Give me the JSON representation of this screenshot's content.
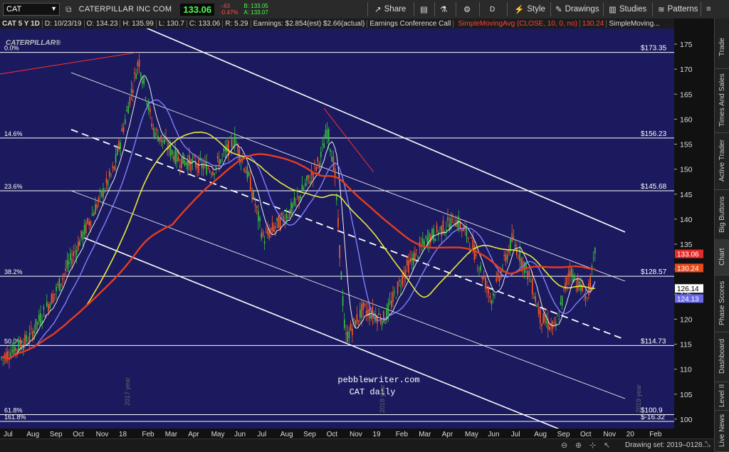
{
  "toolbar": {
    "symbol": "CAT",
    "company": "CATERPILLAR INC COM",
    "last": "133.06",
    "net_change": "-.63",
    "pct_change": "-0.47%",
    "bid": "B: 133.05",
    "ask": "A: 133.07",
    "share": "Share",
    "period": "D",
    "style": "Style",
    "drawings": "Drawings",
    "studies": "Studies",
    "patterns": "Patterns"
  },
  "infobar": {
    "title": "CAT 5 Y 1D",
    "date": "D: 10/23/19",
    "open": "O: 134.23",
    "high": "H: 135.99",
    "low": "L: 130.7",
    "close": "C: 133.06",
    "range": "R: 5.29",
    "earnings": "Earnings: $2.854(est) $2.66(actual)",
    "conf": "Earnings Conference Call",
    "sma": "SimpleMovingAvg (CLOSE, 10, 0, no)",
    "sma_val": "130.24",
    "sma2": "SimpleMoving..."
  },
  "chart": {
    "watermark": "CATERPILLAR®",
    "caption1": "pebblewriter.com",
    "caption2": "CAT daily",
    "year_2017": "2017 year",
    "year_2018": "2018 year",
    "year_2019": "2019 year",
    "fib_levels": [
      {
        "label": "0.0%",
        "price": 173.35,
        "price_label": "$173.35"
      },
      {
        "label": "14.6%",
        "price": 156.23,
        "price_label": "$156.23"
      },
      {
        "label": "23.6%",
        "price": 145.68,
        "price_label": "$145.68"
      },
      {
        "label": "38.2%",
        "price": 128.57,
        "price_label": "$128.57"
      },
      {
        "label": "50.0%",
        "price": 114.73,
        "price_label": "$114.73"
      },
      {
        "label": "61.8%",
        "price": 100.9,
        "price_label": "$100.9"
      },
      {
        "label": "161.8%",
        "price": 99.2,
        "price_label": "$-16.32"
      }
    ]
  },
  "yaxis": {
    "ticks": [
      175,
      170,
      165,
      160,
      155,
      150,
      145,
      140,
      135,
      130,
      125,
      120,
      115,
      110,
      105,
      100
    ],
    "badges": [
      {
        "text": "133.06",
        "price": 133.06,
        "bg": "#e32b2b"
      },
      {
        "text": "130.24",
        "price": 130.24,
        "bg": "#e84a1e"
      },
      {
        "text": "126.14",
        "price": 126.14,
        "bg": "#ffffff"
      },
      {
        "text": "124.13",
        "price": 124.13,
        "bg": "#6a6ae8"
      }
    ],
    "hidden_tick": "13"
  },
  "xaxis": {
    "labels": [
      "Jul",
      "Aug",
      "Sep",
      "Oct",
      "Nov",
      "18",
      "Feb",
      "Mar",
      "Apr",
      "May",
      "Jun",
      "Jul",
      "Aug",
      "Sep",
      "Oct",
      "Nov",
      "19",
      "Feb",
      "Mar",
      "Apr",
      "May",
      "Jun",
      "Jul",
      "Aug",
      "Sep",
      "Oct",
      "Nov",
      "20",
      "Feb"
    ]
  },
  "status": {
    "drawing_set": "Drawing set: 2019–0128..."
  },
  "sidebar": {
    "tabs": [
      "Trade",
      "Times And Sales",
      "Active Trader",
      "Big Buttons",
      "Chart",
      "Phase Scores",
      "Dashboard",
      "Level II",
      "Live News"
    ]
  },
  "colors": {
    "bg": "#1b1a5e",
    "up": "#35c435",
    "down": "#ff5a1f",
    "sma_red": "#e63c1e",
    "sma_yellow": "#e9e93a",
    "sma_blue": "#7f7fff",
    "sma_white": "#ffffff"
  }
}
